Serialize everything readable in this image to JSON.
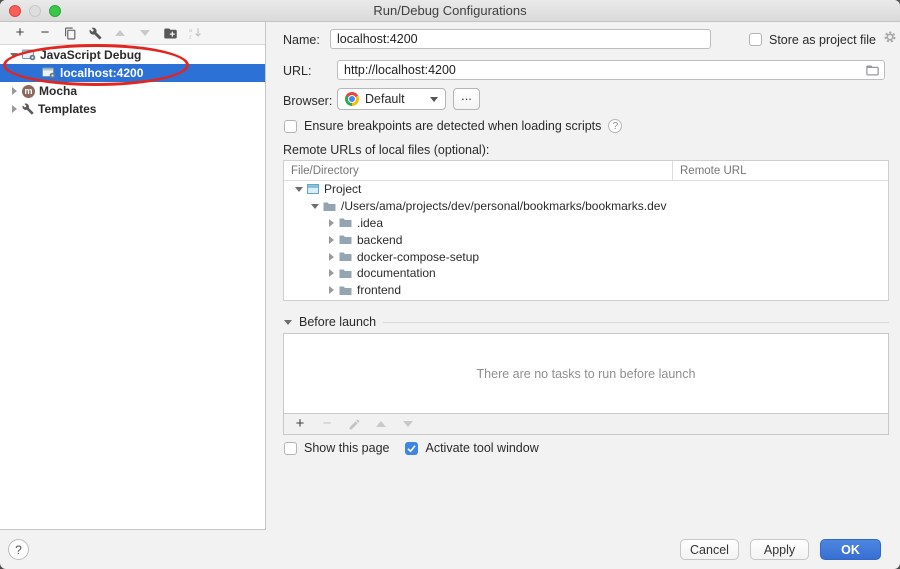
{
  "window": {
    "title": "Run/Debug Configurations"
  },
  "left_toolbar": {
    "buttons": [
      {
        "name": "add",
        "glyph": "+",
        "enabled": true
      },
      {
        "name": "remove",
        "glyph": "−",
        "enabled": true
      },
      {
        "name": "copy-configuration",
        "enabled": true
      },
      {
        "name": "edit-defaults",
        "enabled": true
      },
      {
        "name": "move-up",
        "enabled": false
      },
      {
        "name": "move-down",
        "enabled": false
      },
      {
        "name": "new-folder",
        "enabled": true
      },
      {
        "name": "sort-configurations",
        "enabled": false
      }
    ]
  },
  "config_tree": {
    "items": [
      {
        "label": "JavaScript Debug",
        "type": "javascript-debug",
        "state": "expanded",
        "selected": false
      },
      {
        "label": "localhost:4200",
        "type": "javascript-debug",
        "state": "leaf",
        "selected": true
      },
      {
        "label": "Mocha",
        "type": "mocha",
        "state": "collapsed",
        "selected": false
      },
      {
        "label": "Templates",
        "type": "templates",
        "state": "collapsed",
        "selected": false
      }
    ]
  },
  "annotation": {
    "type": "red-ellipse",
    "around": "JavaScript Debug / localhost:4200"
  },
  "form": {
    "name": {
      "label": "Name:",
      "value": "localhost:4200"
    },
    "store_as_project_file": {
      "label": "Store as project file",
      "checked": false
    },
    "url": {
      "label": "URL:",
      "value": "http://localhost:4200"
    },
    "browser": {
      "label": "Browser:",
      "value": "Default",
      "more_button": "...",
      "help": "?"
    },
    "breakpoints_checkbox": {
      "label": "Ensure breakpoints are detected when loading scripts",
      "checked": false,
      "help": "?"
    },
    "remote_urls_label": "Remote URLs of local files (optional):"
  },
  "remote_urls_table": {
    "columns": [
      "File/Directory",
      "Remote URL"
    ],
    "rows": [
      {
        "label": "Project",
        "icon": "project",
        "indent": 0,
        "state": "expanded",
        "remote_url": ""
      },
      {
        "label": "/Users/ama/projects/dev/personal/bookmarks/bookmarks.dev",
        "icon": "folder",
        "indent": 1,
        "state": "expanded",
        "remote_url": ""
      },
      {
        "label": ".idea",
        "icon": "folder",
        "indent": 2,
        "state": "collapsed",
        "remote_url": ""
      },
      {
        "label": "backend",
        "icon": "folder",
        "indent": 2,
        "state": "collapsed",
        "remote_url": ""
      },
      {
        "label": "docker-compose-setup",
        "icon": "folder",
        "indent": 2,
        "state": "collapsed",
        "remote_url": ""
      },
      {
        "label": "documentation",
        "icon": "folder",
        "indent": 2,
        "state": "collapsed",
        "remote_url": ""
      },
      {
        "label": "frontend",
        "icon": "folder",
        "indent": 2,
        "state": "collapsed",
        "remote_url": ""
      }
    ]
  },
  "before_launch": {
    "title": "Before launch",
    "empty_message": "There are no tasks to run before launch",
    "toolbar": [
      {
        "name": "add-task",
        "glyph": "+",
        "enabled": true
      },
      {
        "name": "remove-task",
        "glyph": "−",
        "enabled": false
      },
      {
        "name": "edit-task",
        "enabled": false
      },
      {
        "name": "move-task-up",
        "enabled": false
      },
      {
        "name": "move-task-down",
        "enabled": false
      }
    ]
  },
  "footer_options": {
    "show_this_page": {
      "label": "Show this page",
      "checked": false
    },
    "activate_tool_window": {
      "label": "Activate tool window",
      "checked": true
    }
  },
  "dialog_buttons": {
    "help": "?",
    "cancel": "Cancel",
    "apply": "Apply",
    "ok": "OK"
  },
  "colors": {
    "selection_blue": "#2b71d6",
    "primary_button_blue": "#3d7cdc",
    "checkbox_checked_blue": "#3e86e0",
    "annotation_red": "#e3251f"
  }
}
